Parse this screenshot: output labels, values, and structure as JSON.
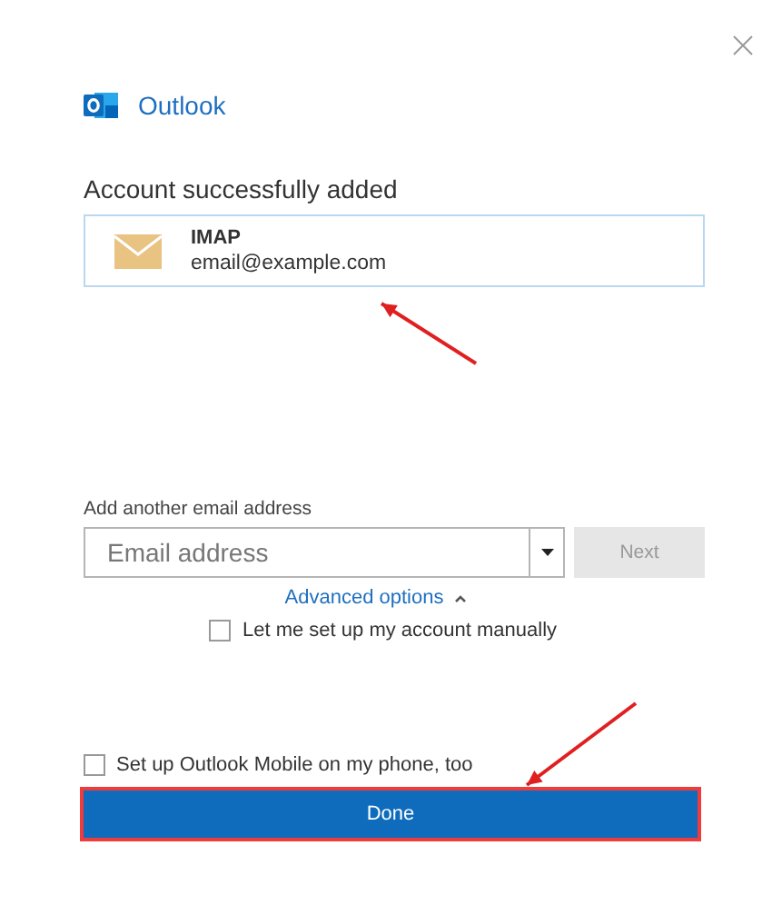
{
  "app": {
    "name": "Outlook"
  },
  "heading": "Account successfully added",
  "account": {
    "type": "IMAP",
    "email": "email@example.com"
  },
  "add_another": {
    "label": "Add another email address",
    "placeholder": "Email address",
    "next_button": {
      "label": "Next",
      "disabled": true
    }
  },
  "advanced_options": {
    "label": "Advanced options",
    "expanded": true
  },
  "manual_setup": {
    "label": "Let me set up my account manually",
    "checked": false
  },
  "mobile_setup": {
    "label": "Set up Outlook Mobile on my phone, too",
    "checked": false
  },
  "done_button": {
    "label": "Done",
    "highlighted": true
  }
}
